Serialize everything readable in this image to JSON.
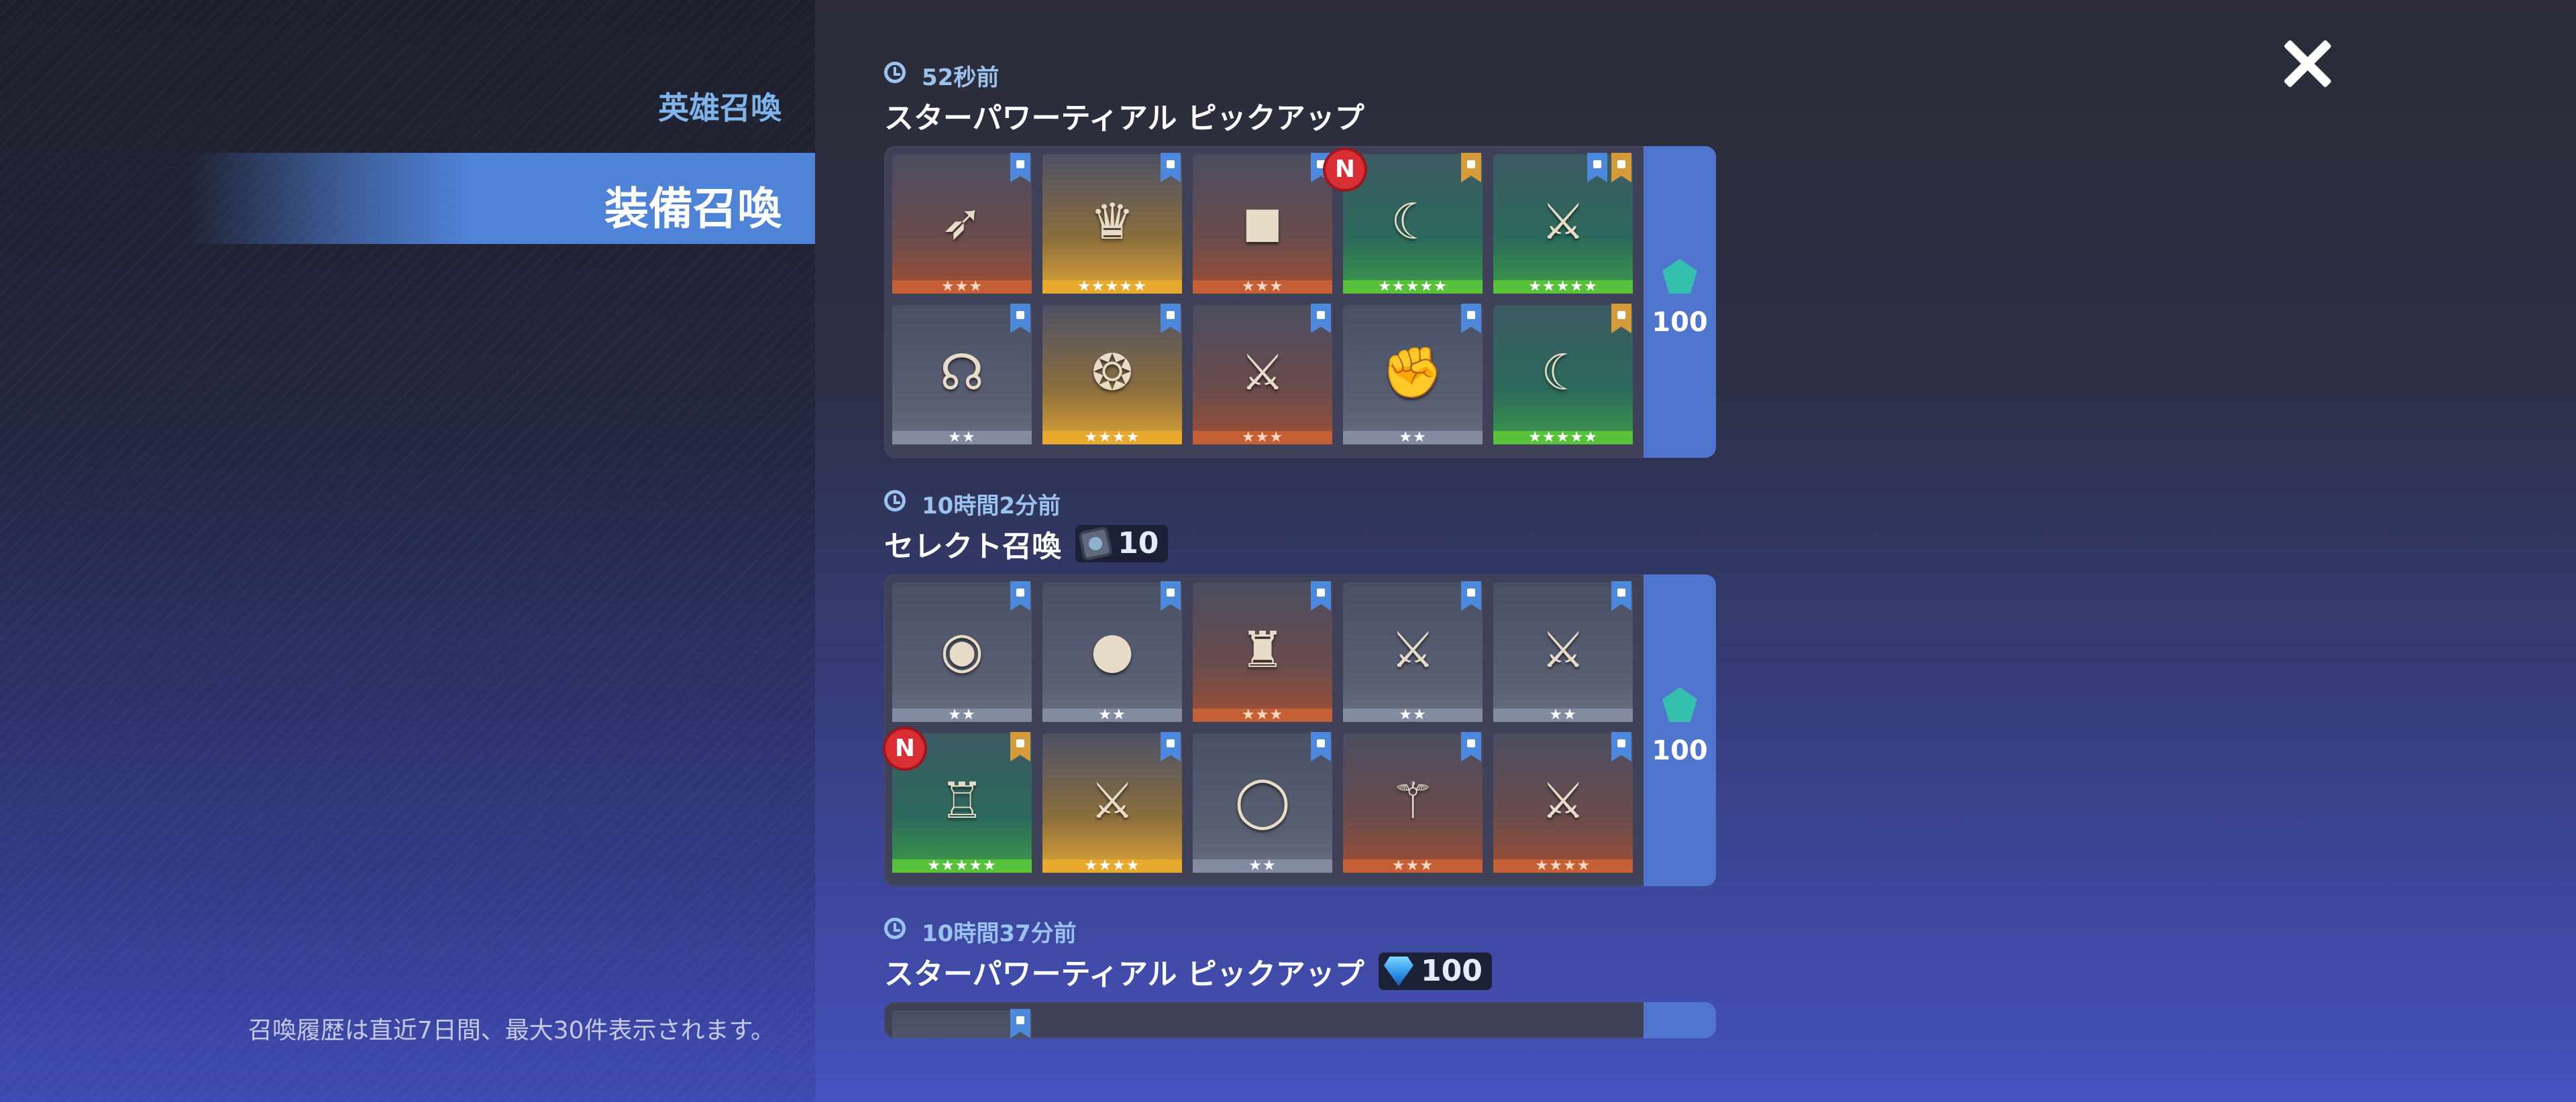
{
  "sidebar": {
    "tab_hero": "英雄召喚",
    "tab_equipment": "装備召喚",
    "note": "召喚履歴は直近7日間、最大30件表示されます。"
  },
  "entries": [
    {
      "time": "52秒前",
      "title": "スターパワーティアル ピックアップ",
      "cost": null,
      "reward": "100",
      "items": [
        {
          "glyph": "➶",
          "stars": "★★★",
          "rarity": "bronze",
          "flag": "blue",
          "new": false
        },
        {
          "glyph": "♛",
          "stars": "★★★★★",
          "rarity": "gold",
          "flag": "blue",
          "new": false
        },
        {
          "glyph": "◼",
          "stars": "★★★",
          "rarity": "bronze",
          "flag": "blue",
          "new": false
        },
        {
          "glyph": "☾",
          "stars": "★★★★★",
          "rarity": "green",
          "flag": "gold",
          "new": true
        },
        {
          "glyph": "⚔",
          "stars": "★★★★★",
          "rarity": "green",
          "flag": "blue+gold",
          "new": false
        },
        {
          "glyph": "☊",
          "stars": "★★",
          "rarity": "silver",
          "flag": "blue",
          "new": false
        },
        {
          "glyph": "❂",
          "stars": "★★★★",
          "rarity": "gold",
          "flag": "blue",
          "new": false
        },
        {
          "glyph": "⚔",
          "stars": "★★★",
          "rarity": "bronze",
          "flag": "blue",
          "new": false
        },
        {
          "glyph": "✊",
          "stars": "★★",
          "rarity": "silver",
          "flag": "blue",
          "new": false
        },
        {
          "glyph": "☾",
          "stars": "★★★★★",
          "rarity": "green",
          "flag": "gold",
          "new": false
        }
      ]
    },
    {
      "time": "10時間2分前",
      "title": "セレクト召喚",
      "cost": "10",
      "cost_icon": "ticket-icon",
      "reward": "100",
      "items": [
        {
          "glyph": "◉",
          "stars": "★★",
          "rarity": "silver",
          "flag": "blue",
          "new": false
        },
        {
          "glyph": "●",
          "stars": "★★",
          "rarity": "silver",
          "flag": "blue",
          "new": false
        },
        {
          "glyph": "♜",
          "stars": "★★★",
          "rarity": "bronze",
          "flag": "blue",
          "new": false
        },
        {
          "glyph": "⚔",
          "stars": "★★",
          "rarity": "silver",
          "flag": "blue",
          "new": false
        },
        {
          "glyph": "⚔",
          "stars": "★★",
          "rarity": "silver",
          "flag": "blue",
          "new": false
        },
        {
          "glyph": "♖",
          "stars": "★★★★★",
          "rarity": "green",
          "flag": "gold",
          "new": true
        },
        {
          "glyph": "⚔",
          "stars": "★★★★",
          "rarity": "gold",
          "flag": "blue",
          "new": false
        },
        {
          "glyph": "◯",
          "stars": "★★",
          "rarity": "silver",
          "flag": "blue",
          "new": false
        },
        {
          "glyph": "⚚",
          "stars": "★★★",
          "rarity": "bronze",
          "flag": "blue",
          "new": false
        },
        {
          "glyph": "⚔",
          "stars": "★★★★",
          "rarity": "bronze",
          "flag": "blue",
          "new": false
        }
      ]
    },
    {
      "time": "10時間37分前",
      "title": "スターパワーティアル ピックアップ",
      "cost": "100",
      "cost_icon": "gem-icon"
    }
  ],
  "colors": {
    "accent": "#4f83d8",
    "time_text": "#9bc3ef",
    "new_badge": "#d92e34"
  }
}
